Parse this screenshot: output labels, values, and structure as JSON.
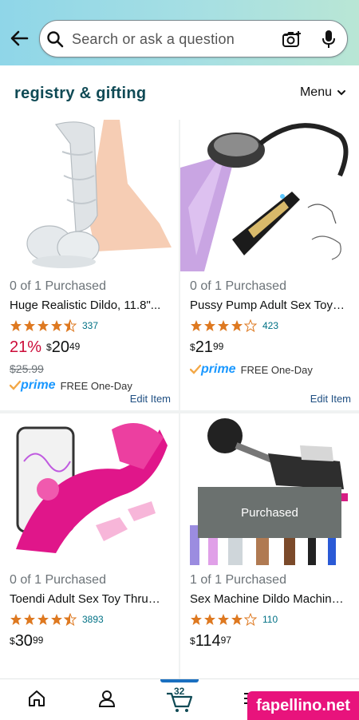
{
  "header": {
    "search_placeholder": "Search or ask a question"
  },
  "registry": {
    "title": "registry & gifting",
    "menu_label": "Menu"
  },
  "items": [
    {
      "purchased": "0 of 1 Purchased",
      "title": "Huge Realistic Dildo, 11.8\"...",
      "rating": 4.5,
      "rating_count": "337",
      "discount": "21%",
      "currency": "$",
      "price_whole": "20",
      "price_fraction": "49",
      "list_price": "$25.99",
      "prime": "prime",
      "delivery": "FREE One-Day",
      "edit": "Edit Item"
    },
    {
      "purchased": "0 of 1 Purchased",
      "title": "Pussy Pump Adult Sex Toy…",
      "rating": 4.0,
      "rating_count": "423",
      "currency": "$",
      "price_whole": "21",
      "price_fraction": "99",
      "prime": "prime",
      "delivery": "FREE One-Day",
      "edit": "Edit Item"
    },
    {
      "purchased": "0 of 1 Purchased",
      "title": "Toendi Adult Sex Toy Thru…",
      "rating": 4.5,
      "rating_count": "3893",
      "currency": "$",
      "price_whole": "30",
      "price_fraction": "99"
    },
    {
      "purchased": "1 of 1 Purchased",
      "title": "Sex Machine Dildo Machin…",
      "rating": 4.0,
      "rating_count": "110",
      "currency": "$",
      "price_whole": "114",
      "price_fraction": "97"
    }
  ],
  "overlay": {
    "label": "Purchased"
  },
  "bottom_nav": {
    "cart_count": "32",
    "icons": [
      "home-icon",
      "account-icon",
      "cart-icon",
      "menu-icon",
      "ai-assistant-icon"
    ]
  },
  "watermark": "fapellino.net",
  "colors": {
    "accent": "#007185",
    "discount": "#cc0c39",
    "prime": "#1a98ff",
    "star": "#de7921"
  }
}
